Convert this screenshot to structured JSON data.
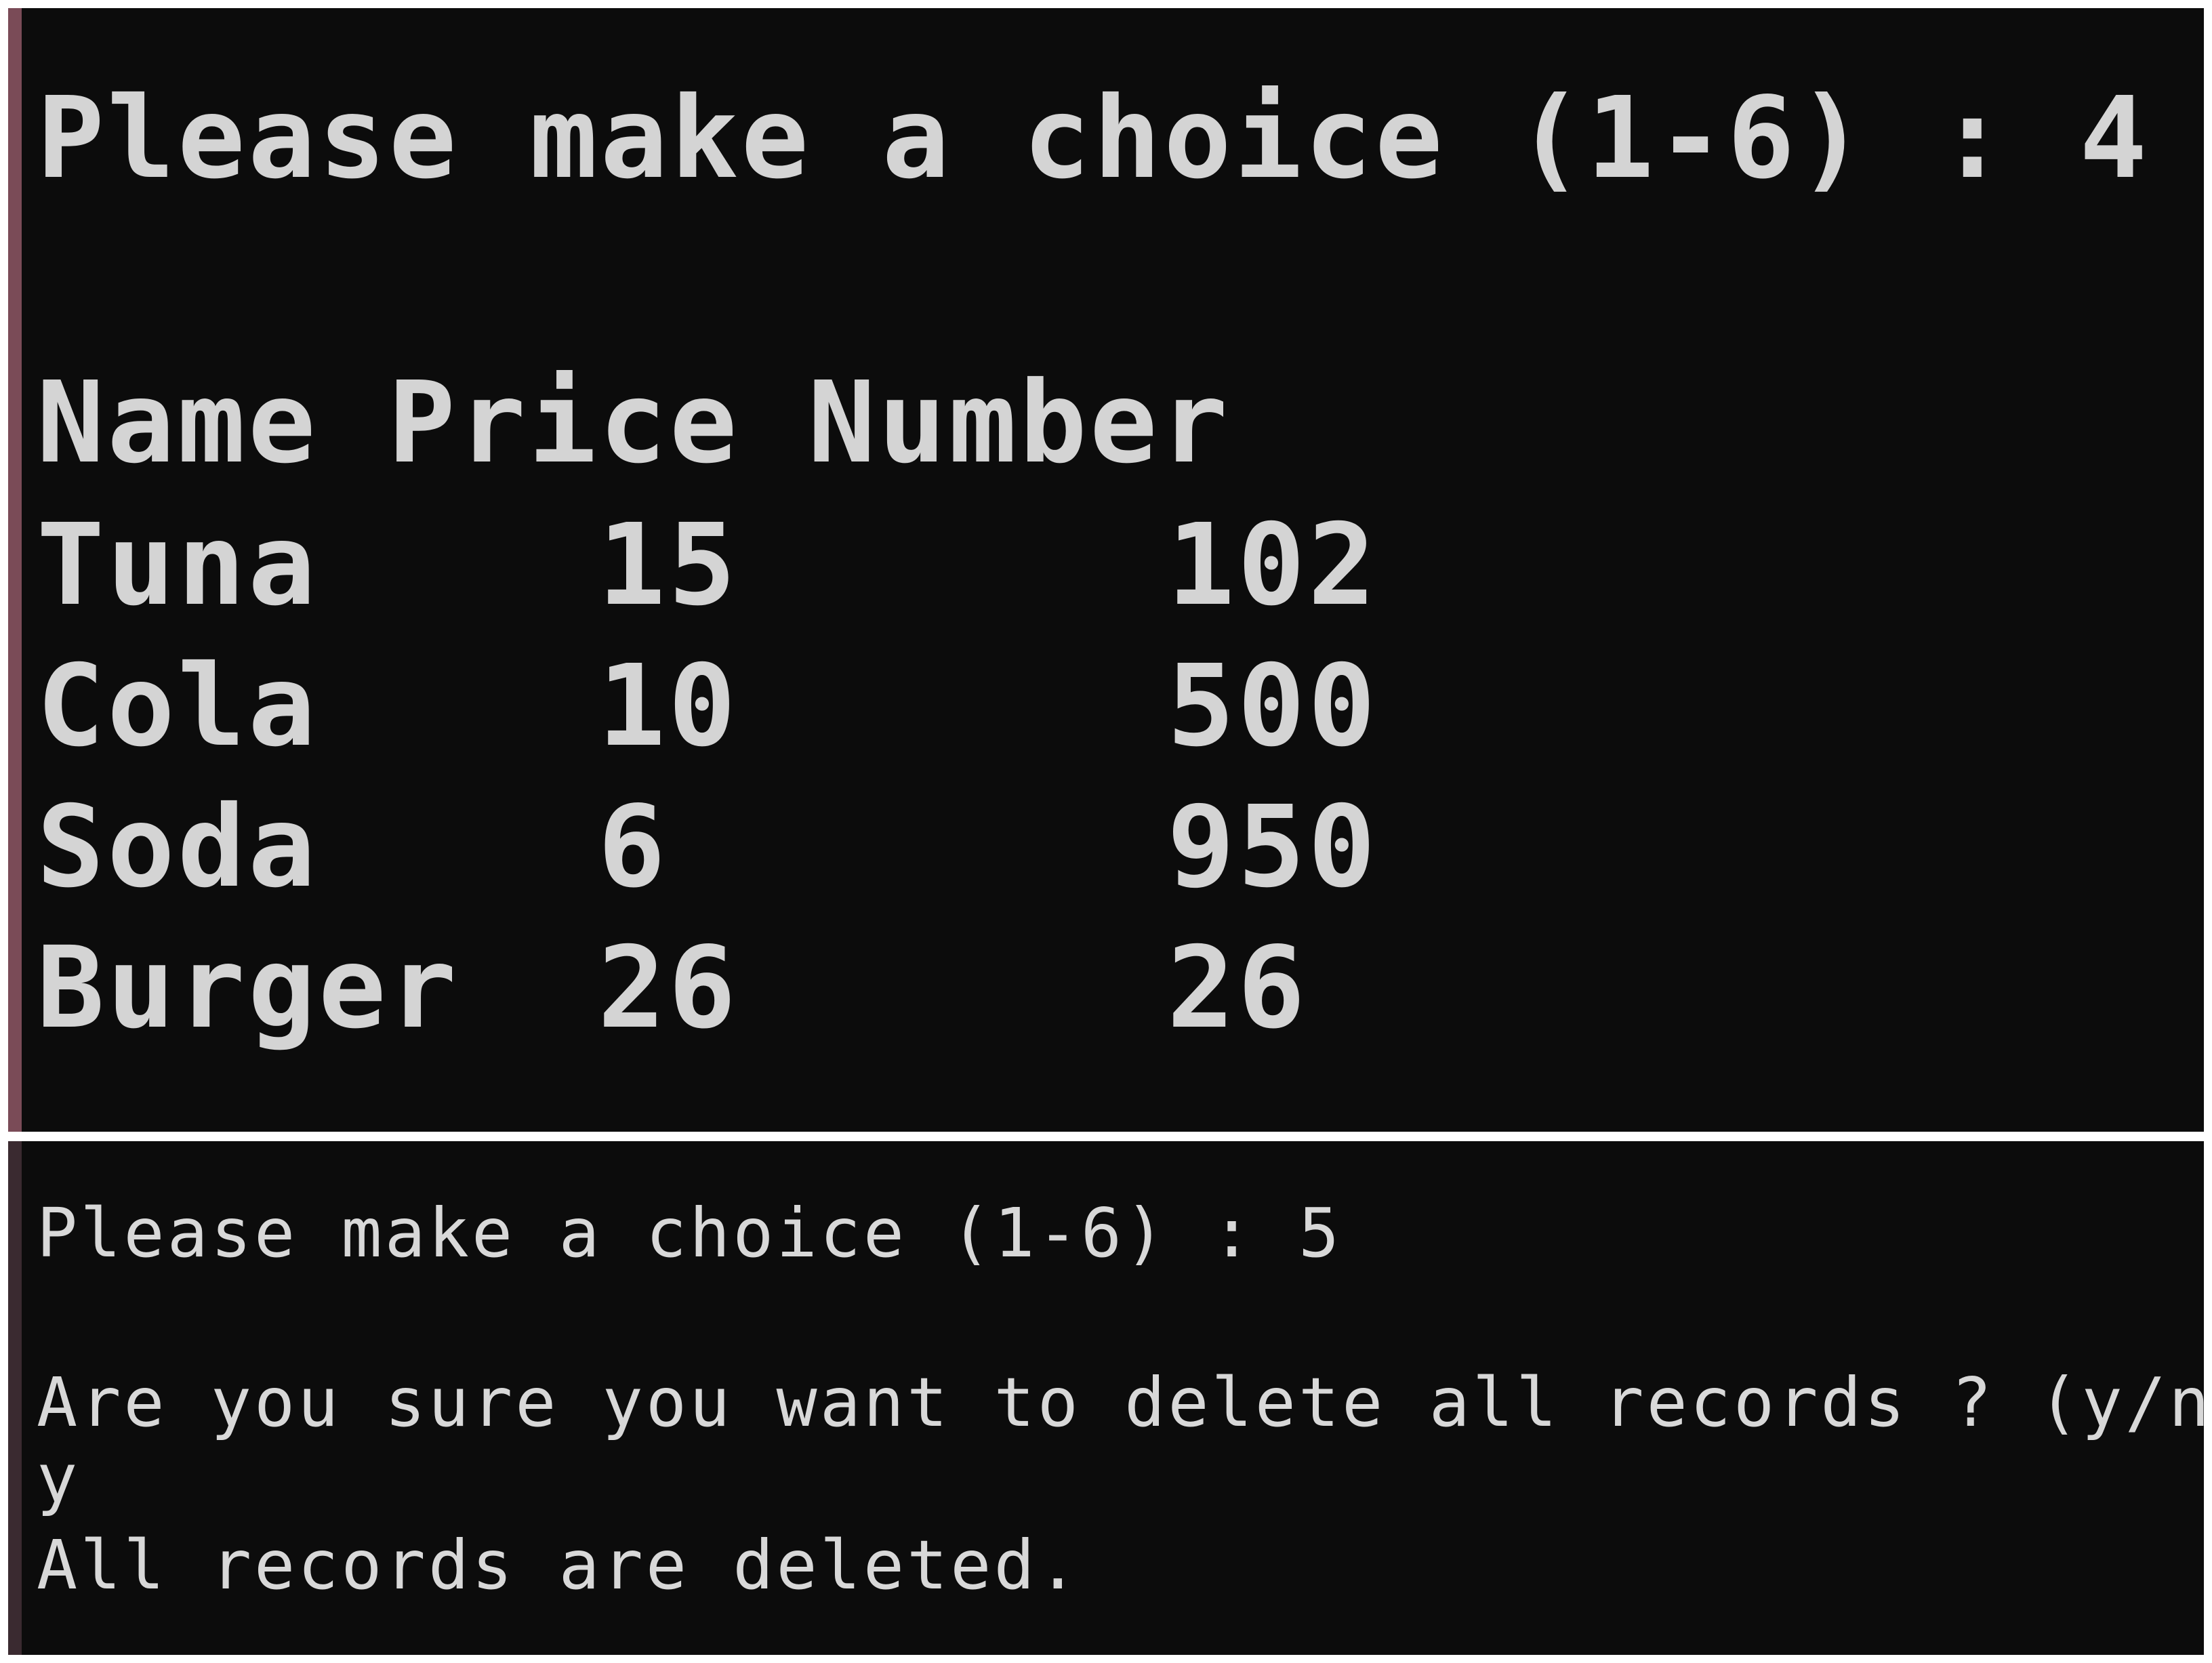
{
  "top_panel": {
    "prompt": "Please make a choice (1-6) : 4",
    "table": {
      "headers": [
        "Name",
        "Price",
        "Number"
      ],
      "rows": [
        {
          "name": "Tuna",
          "price": "15",
          "number": "102"
        },
        {
          "name": "Cola",
          "price": "10",
          "number": "500"
        },
        {
          "name": "Soda",
          "price": "6",
          "number": "950"
        },
        {
          "name": "Burger",
          "price": "26",
          "number": "26"
        }
      ]
    }
  },
  "bottom_panel": {
    "prompt": "Please make a choice (1-6) : 5",
    "question": "Are you sure you want to delete all records ? (y/n)",
    "answer": "y",
    "result": "All records are deleted."
  },
  "colors": {
    "terminal_background": "#0c0c0c",
    "terminal_text": "#cccccc",
    "top_border_accent": "#7a4b57"
  }
}
